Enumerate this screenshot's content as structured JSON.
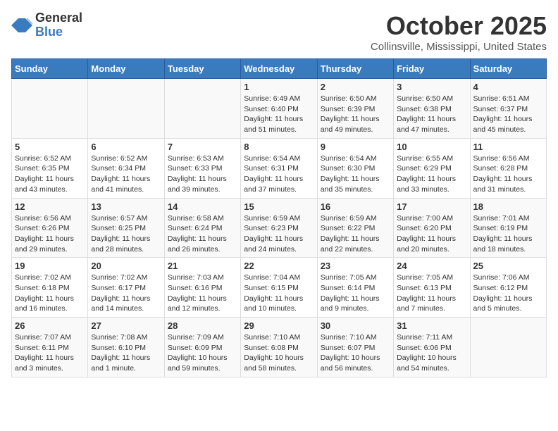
{
  "logo": {
    "general": "General",
    "blue": "Blue"
  },
  "title": "October 2025",
  "location": "Collinsville, Mississippi, United States",
  "days_of_week": [
    "Sunday",
    "Monday",
    "Tuesday",
    "Wednesday",
    "Thursday",
    "Friday",
    "Saturday"
  ],
  "weeks": [
    [
      {
        "day": "",
        "details": ""
      },
      {
        "day": "",
        "details": ""
      },
      {
        "day": "",
        "details": ""
      },
      {
        "day": "1",
        "details": "Sunrise: 6:49 AM\nSunset: 6:40 PM\nDaylight: 11 hours\nand 51 minutes."
      },
      {
        "day": "2",
        "details": "Sunrise: 6:50 AM\nSunset: 6:39 PM\nDaylight: 11 hours\nand 49 minutes."
      },
      {
        "day": "3",
        "details": "Sunrise: 6:50 AM\nSunset: 6:38 PM\nDaylight: 11 hours\nand 47 minutes."
      },
      {
        "day": "4",
        "details": "Sunrise: 6:51 AM\nSunset: 6:37 PM\nDaylight: 11 hours\nand 45 minutes."
      }
    ],
    [
      {
        "day": "5",
        "details": "Sunrise: 6:52 AM\nSunset: 6:35 PM\nDaylight: 11 hours\nand 43 minutes."
      },
      {
        "day": "6",
        "details": "Sunrise: 6:52 AM\nSunset: 6:34 PM\nDaylight: 11 hours\nand 41 minutes."
      },
      {
        "day": "7",
        "details": "Sunrise: 6:53 AM\nSunset: 6:33 PM\nDaylight: 11 hours\nand 39 minutes."
      },
      {
        "day": "8",
        "details": "Sunrise: 6:54 AM\nSunset: 6:31 PM\nDaylight: 11 hours\nand 37 minutes."
      },
      {
        "day": "9",
        "details": "Sunrise: 6:54 AM\nSunset: 6:30 PM\nDaylight: 11 hours\nand 35 minutes."
      },
      {
        "day": "10",
        "details": "Sunrise: 6:55 AM\nSunset: 6:29 PM\nDaylight: 11 hours\nand 33 minutes."
      },
      {
        "day": "11",
        "details": "Sunrise: 6:56 AM\nSunset: 6:28 PM\nDaylight: 11 hours\nand 31 minutes."
      }
    ],
    [
      {
        "day": "12",
        "details": "Sunrise: 6:56 AM\nSunset: 6:26 PM\nDaylight: 11 hours\nand 29 minutes."
      },
      {
        "day": "13",
        "details": "Sunrise: 6:57 AM\nSunset: 6:25 PM\nDaylight: 11 hours\nand 28 minutes."
      },
      {
        "day": "14",
        "details": "Sunrise: 6:58 AM\nSunset: 6:24 PM\nDaylight: 11 hours\nand 26 minutes."
      },
      {
        "day": "15",
        "details": "Sunrise: 6:59 AM\nSunset: 6:23 PM\nDaylight: 11 hours\nand 24 minutes."
      },
      {
        "day": "16",
        "details": "Sunrise: 6:59 AM\nSunset: 6:22 PM\nDaylight: 11 hours\nand 22 minutes."
      },
      {
        "day": "17",
        "details": "Sunrise: 7:00 AM\nSunset: 6:20 PM\nDaylight: 11 hours\nand 20 minutes."
      },
      {
        "day": "18",
        "details": "Sunrise: 7:01 AM\nSunset: 6:19 PM\nDaylight: 11 hours\nand 18 minutes."
      }
    ],
    [
      {
        "day": "19",
        "details": "Sunrise: 7:02 AM\nSunset: 6:18 PM\nDaylight: 11 hours\nand 16 minutes."
      },
      {
        "day": "20",
        "details": "Sunrise: 7:02 AM\nSunset: 6:17 PM\nDaylight: 11 hours\nand 14 minutes."
      },
      {
        "day": "21",
        "details": "Sunrise: 7:03 AM\nSunset: 6:16 PM\nDaylight: 11 hours\nand 12 minutes."
      },
      {
        "day": "22",
        "details": "Sunrise: 7:04 AM\nSunset: 6:15 PM\nDaylight: 11 hours\nand 10 minutes."
      },
      {
        "day": "23",
        "details": "Sunrise: 7:05 AM\nSunset: 6:14 PM\nDaylight: 11 hours\nand 9 minutes."
      },
      {
        "day": "24",
        "details": "Sunrise: 7:05 AM\nSunset: 6:13 PM\nDaylight: 11 hours\nand 7 minutes."
      },
      {
        "day": "25",
        "details": "Sunrise: 7:06 AM\nSunset: 6:12 PM\nDaylight: 11 hours\nand 5 minutes."
      }
    ],
    [
      {
        "day": "26",
        "details": "Sunrise: 7:07 AM\nSunset: 6:11 PM\nDaylight: 11 hours\nand 3 minutes."
      },
      {
        "day": "27",
        "details": "Sunrise: 7:08 AM\nSunset: 6:10 PM\nDaylight: 11 hours\nand 1 minute."
      },
      {
        "day": "28",
        "details": "Sunrise: 7:09 AM\nSunset: 6:09 PM\nDaylight: 10 hours\nand 59 minutes."
      },
      {
        "day": "29",
        "details": "Sunrise: 7:10 AM\nSunset: 6:08 PM\nDaylight: 10 hours\nand 58 minutes."
      },
      {
        "day": "30",
        "details": "Sunrise: 7:10 AM\nSunset: 6:07 PM\nDaylight: 10 hours\nand 56 minutes."
      },
      {
        "day": "31",
        "details": "Sunrise: 7:11 AM\nSunset: 6:06 PM\nDaylight: 10 hours\nand 54 minutes."
      },
      {
        "day": "",
        "details": ""
      }
    ]
  ]
}
